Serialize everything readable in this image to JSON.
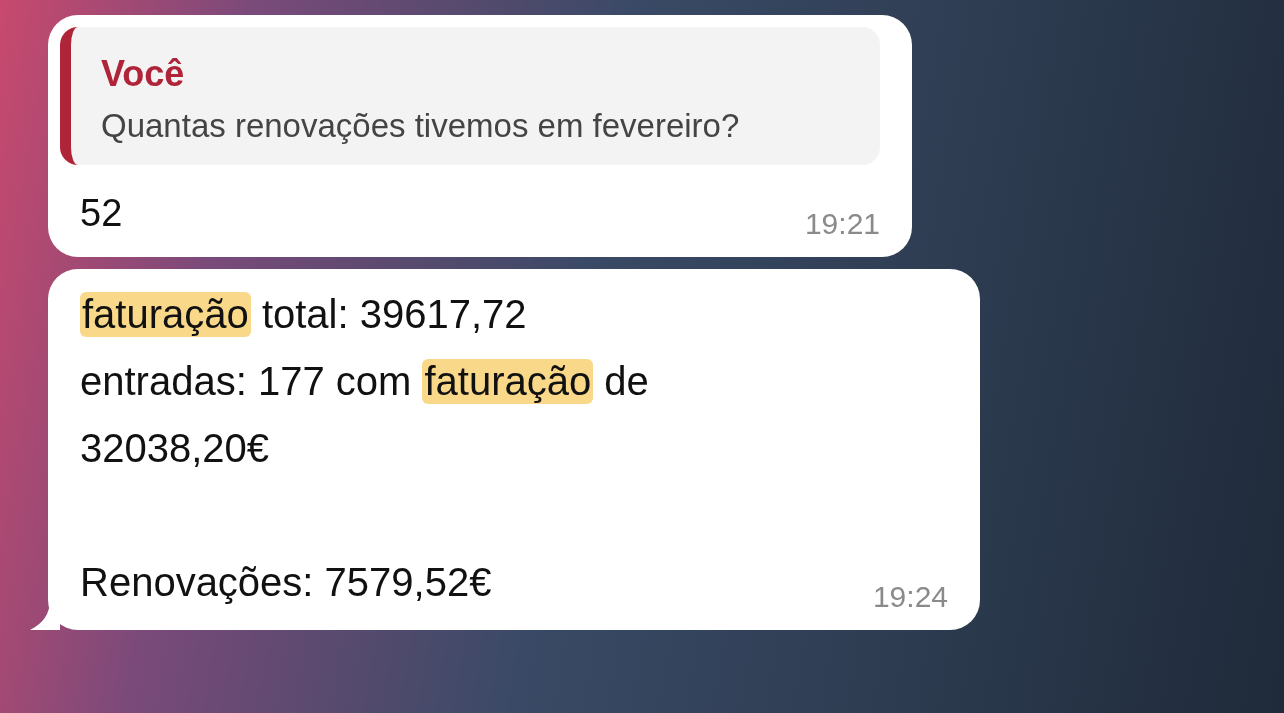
{
  "messages": [
    {
      "kind": "reply",
      "quote": {
        "author": "Você",
        "text": "Quantas renovações tivemos em fevereiro?"
      },
      "paragraphs": [
        [
          [
            {
              "text": "52",
              "highlighted": false
            }
          ]
        ]
      ],
      "time": "19:21",
      "tail": false
    },
    {
      "kind": "text",
      "paragraphs": [
        [
          [
            {
              "text": "faturação",
              "highlighted": true
            },
            {
              "text": " total: 39617,72",
              "highlighted": false
            }
          ],
          [
            {
              "text": "entradas: 177 com ",
              "highlighted": false
            },
            {
              "text": "faturação",
              "highlighted": true
            },
            {
              "text": " de",
              "highlighted": false
            }
          ],
          [
            {
              "text": "32038,20€",
              "highlighted": false
            }
          ]
        ],
        [
          [
            {
              "text": "Renovações: 7579,52€",
              "highlighted": false
            }
          ]
        ]
      ],
      "time": "19:24",
      "tail": true
    }
  ]
}
